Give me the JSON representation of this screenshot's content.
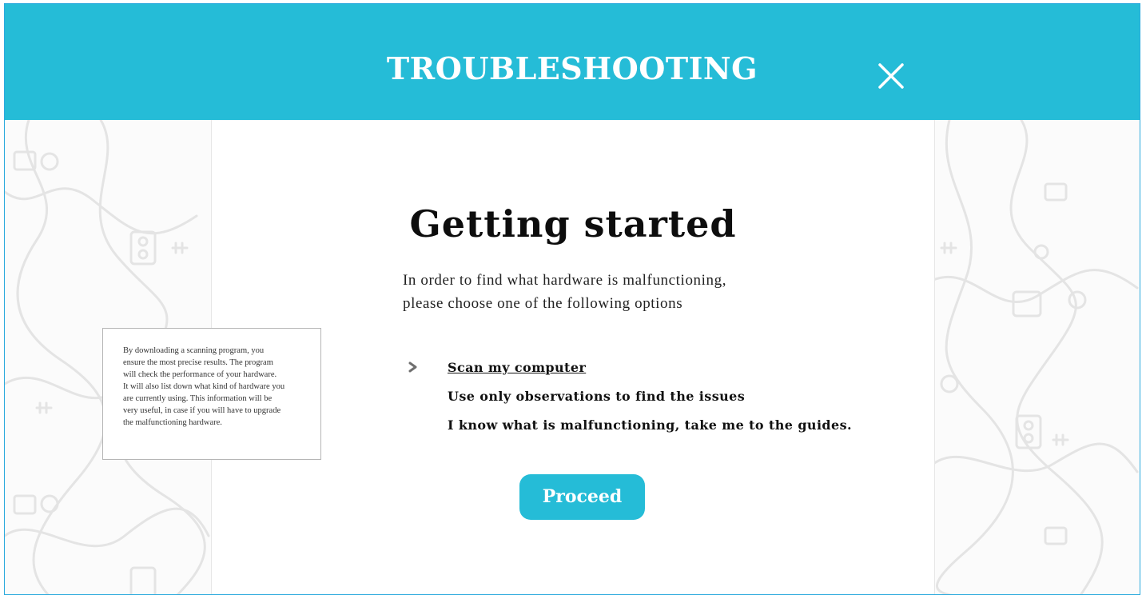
{
  "header": {
    "title": "TROUBLESHOOTING",
    "close_icon": "close-icon"
  },
  "main": {
    "title": "Getting started",
    "intro_line1": "In order to find what hardware is malfunctioning,",
    "intro_line2": "please choose one of the following options",
    "options": [
      {
        "label": "Scan my computer",
        "selected": true
      },
      {
        "label": "Use only observations to find the issues",
        "selected": false
      },
      {
        "label": "I know what is malfunctioning, take me to the guides.",
        "selected": false
      }
    ],
    "selected_icon": "chevron-right-icon",
    "proceed_label": "Proceed"
  },
  "tooltip": {
    "text": "By downloading a scanning program, you\nensure the most precise results. The program\nwill check  the performance of your hardware.\nIt will also list down what kind of hardware you\nare currently using. This information will be\nvery useful, in case if you will have to upgrade\nthe malfunctioning hardware."
  },
  "background": {
    "pattern_icon": "cable-doodle-pattern"
  },
  "colors": {
    "accent": "#25bcd7",
    "frame_border": "#2aa9dd",
    "doodle": "#e4e4e4"
  }
}
